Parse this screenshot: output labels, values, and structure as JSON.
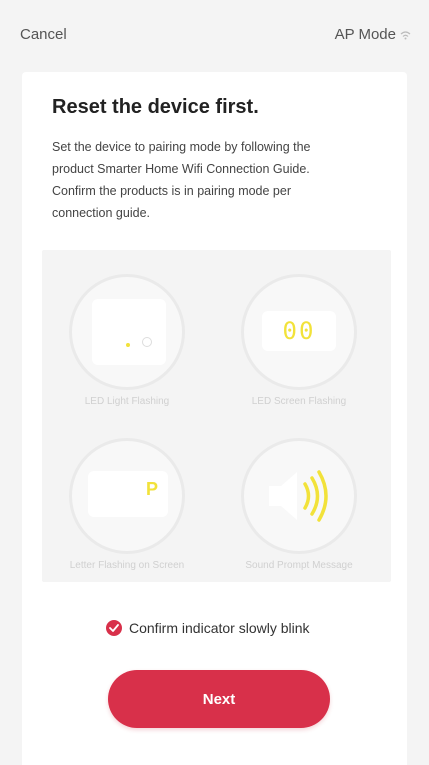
{
  "header": {
    "cancel_label": "Cancel",
    "mode_label": "AP Mode",
    "mode_icon": "wifi-caret-icon"
  },
  "main": {
    "title": "Reset the device first.",
    "description": "Set the device to pairing mode by following the product Smarter Home Wifi Connection Guide. Confirm the products is in pairing mode per connection guide.",
    "illustrations": [
      {
        "label": "LED Light Flashing",
        "icon": "light-indicator-icon"
      },
      {
        "label": "LED Screen Flashing",
        "display": "00",
        "icon": "led-screen-icon"
      },
      {
        "label": "Letter Flashing on Screen",
        "display": "P",
        "icon": "letter-screen-icon"
      },
      {
        "label": "Sound Prompt Message",
        "icon": "speaker-icon"
      }
    ],
    "confirm_label": "Confirm indicator slowly blink",
    "confirm_checked": true,
    "next_label": "Next"
  },
  "colors": {
    "accent": "#d8304a",
    "indicator_yellow": "#f2e23a",
    "background": "#f4f4f4"
  }
}
